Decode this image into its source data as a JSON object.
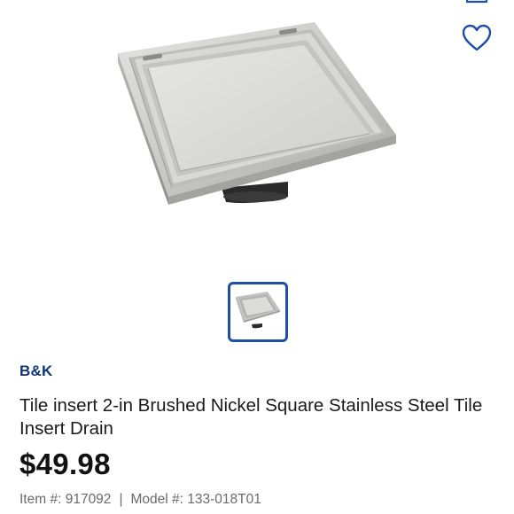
{
  "product": {
    "brand": "B&K",
    "title": "Tile insert 2-in Brushed Nickel Square Stainless Steel Tile Insert Drain",
    "price": "$49.98",
    "item_label": "Item #:",
    "item_number": "917092",
    "separator": "|",
    "model_label": "Model #:",
    "model_number": "133-018T01"
  },
  "icons": {
    "share": "share-icon",
    "favorite": "heart-outline-icon"
  },
  "colors": {
    "brand": "#10357a",
    "thumb_border": "#1d4fa8",
    "meta_text": "#6b6b6b"
  }
}
